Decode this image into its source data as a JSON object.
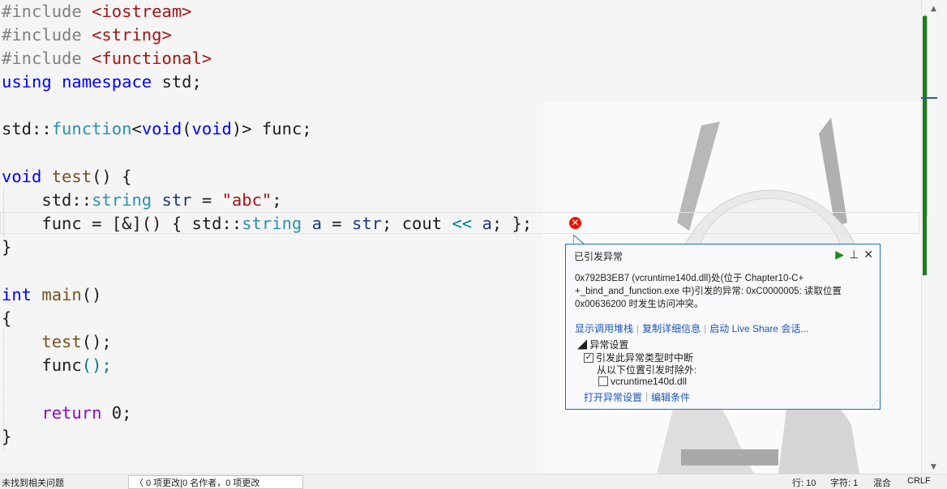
{
  "code": {
    "line1": {
      "pp": "#include",
      "inc": "<iostream>"
    },
    "line2": {
      "pp": "#include",
      "inc": "<string>"
    },
    "line3": {
      "pp": "#include",
      "inc": "<functional>"
    },
    "line4": {
      "k1": "using",
      "k2": "namespace",
      "rest": " std;"
    },
    "line6": {
      "a": "std::",
      "b": "function",
      "c": "<",
      "d": "void",
      "e": "(",
      "f": "void",
      "g": ")> func;"
    },
    "line8": {
      "k": "void",
      "fn": " test",
      "rest": "() {"
    },
    "line9": {
      "a": "    std::",
      "ty": "string",
      "var": " str",
      "op": " = ",
      "str": "\"abc\"",
      "end": ";"
    },
    "line10": {
      "a": "    func = [&]() { std::",
      "ty": "string",
      "var": " a",
      "b": " = ",
      "v2": "str",
      "c": "; cout ",
      "op": "<<",
      "v3": " a",
      "d": "; };"
    },
    "line11": "}",
    "line13": {
      "k": "int",
      "fn": " main",
      "rest": "()"
    },
    "line14": "{",
    "line15": {
      "fn": "    test",
      "rest": "();"
    },
    "line16": {
      "a": "    func",
      "b": "();"
    },
    "line18": {
      "k": "    return",
      "rest": " 0;"
    },
    "line19": "}"
  },
  "exception": {
    "title": "已引发异常",
    "message": "0x792B3EB7 (vcruntime140d.dll)处(位于 Chapter10-C+ +_bind_and_function.exe 中)引发的异常: 0xC0000005: 读取位置 0x00636200 时发生访问冲突。",
    "link_callstack": "显示调用堆栈",
    "link_copy": "复制详细信息",
    "link_liveshare": "启动 Live Share 会话...",
    "settings_header": "异常设置",
    "break_label": "引发此异常类型时中断",
    "except_label": "从以下位置引发时除外:",
    "dll_label": "vcruntime140d.dll",
    "link_open_settings": "打开异常设置",
    "link_edit_conditions": "编辑条件"
  },
  "status": {
    "issues": "未找到相关问题",
    "changes": "0 项更改|0 名作者，0 项更改",
    "line": "行: 10",
    "char": "字符: 1",
    "mixed": "混合",
    "eol": "CRLF"
  },
  "colors": {
    "keyword": "#0000ff",
    "type": "#2b91af",
    "string": "#a31515",
    "accent": "#1f6fb2",
    "error": "#e51400"
  }
}
